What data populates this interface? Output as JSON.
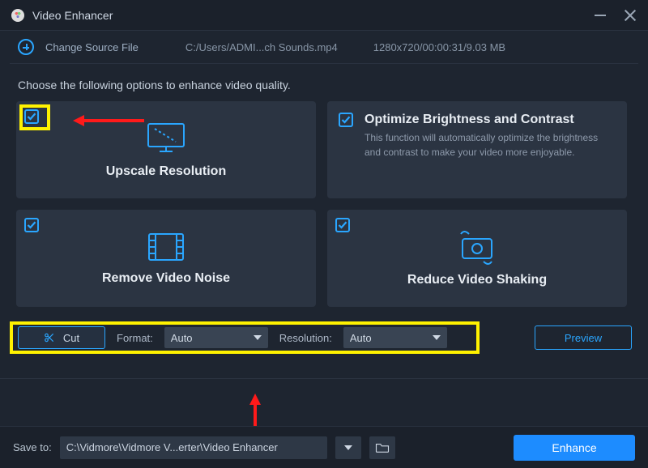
{
  "window": {
    "title": "Video Enhancer"
  },
  "source": {
    "change_label": "Change Source File",
    "path": "C:/Users/ADMI...ch Sounds.mp4",
    "meta": "1280x720/00:00:31/9.03 MB"
  },
  "instruction": "Choose the following options to enhance video quality.",
  "options": {
    "upscale": {
      "title": "Upscale Resolution"
    },
    "optimize": {
      "title": "Optimize Brightness and Contrast",
      "desc": "This function will automatically optimize the brightness and contrast to make your video more enjoyable."
    },
    "denoise": {
      "title": "Remove Video Noise"
    },
    "deshake": {
      "title": "Reduce Video Shaking"
    }
  },
  "controls": {
    "cut_label": "Cut",
    "format_label": "Format:",
    "format_value": "Auto",
    "resolution_label": "Resolution:",
    "resolution_value": "Auto",
    "preview_label": "Preview"
  },
  "save": {
    "label": "Save to:",
    "path": "C:\\Vidmore\\Vidmore V...erter\\Video Enhancer",
    "enhance_label": "Enhance"
  },
  "colors": {
    "accent": "#2aa6ff",
    "highlight": "#fff200"
  }
}
